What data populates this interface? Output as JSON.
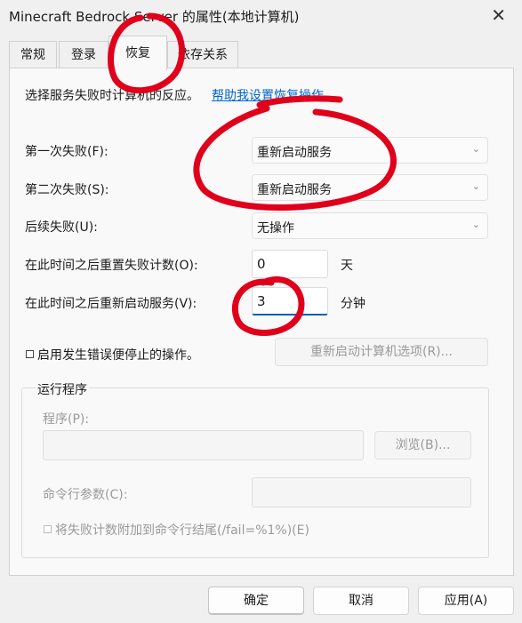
{
  "window": {
    "title": "Minecraft Bedrock Server 的属性(本地计算机)",
    "close_glyph": "✕"
  },
  "tabs": [
    "常规",
    "登录",
    "恢复",
    "依存关系"
  ],
  "recovery": {
    "intro": "选择服务失败时计算机的反应。",
    "help_link": "帮助我设置恢复操作。",
    "first_failure_label": "第一次失败(F):",
    "first_failure_value": "重新启动服务",
    "second_failure_label": "第二次失败(S):",
    "second_failure_value": "重新启动服务",
    "subsequent_failure_label": "后续失败(U):",
    "subsequent_failure_value": "无操作",
    "reset_count_label": "在此时间之后重置失败计数(O):",
    "reset_count_value": "0",
    "reset_count_unit": "天",
    "restart_service_label": "在此时间之后重新启动服务(V):",
    "restart_service_value": "3",
    "restart_service_unit": "分钟",
    "enable_stop_actions_label": "启用发生错误便停止的操作。",
    "restart_computer_options": "重新启动计算机选项(R)..."
  },
  "run_program": {
    "group_label": "运行程序",
    "program_label": "程序(P):",
    "browse": "浏览(B)...",
    "cmd_params_label": "命令行参数(C):",
    "append_fail_label": "将失败计数附加到命令行结尾(/fail=%1%)(E)"
  },
  "footer": {
    "ok": "确定",
    "cancel": "取消",
    "apply": "应用(A)"
  },
  "colors": {
    "annotation": "#e0001b",
    "link": "#0066cc"
  },
  "icons": {
    "dropdown": "chevron-down-icon"
  }
}
